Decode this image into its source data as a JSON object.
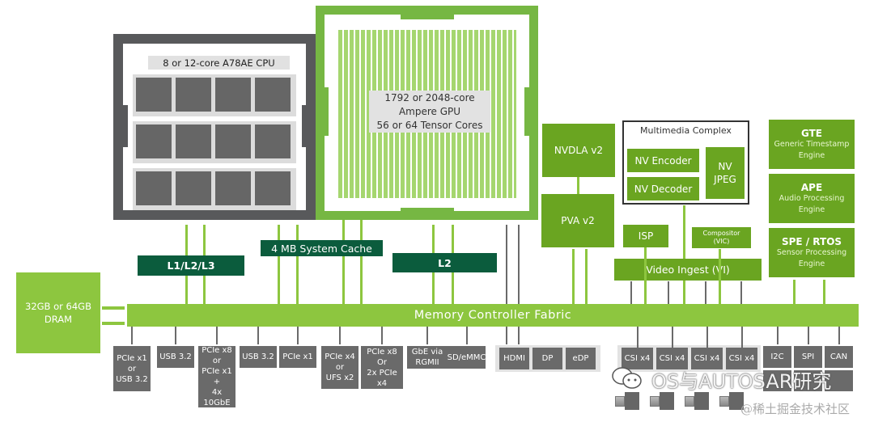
{
  "cpu": {
    "label": "8 or 12-core A78AE CPU",
    "core_rows": 3,
    "cores_per_row": 4
  },
  "gpu": {
    "label": "1792 or 2048-core\nAmpere GPU\n56 or 64 Tensor  Cores"
  },
  "caches": {
    "cpu": "L1/L2/L3",
    "system": "4 MB System Cache",
    "gpu": "L2"
  },
  "fabric": {
    "label": "Memory Controller Fabric"
  },
  "dram": {
    "label": "32GB or 64GB\nDRAM"
  },
  "accelerators": {
    "nvdla": "NVDLA v2",
    "pva": "PVA v2"
  },
  "multimedia": {
    "title": "Multimedia Complex",
    "encoder": "NV Encoder",
    "decoder": "NV Decoder",
    "jpeg": "NV\nJPEG"
  },
  "video": {
    "isp": "ISP",
    "compositor": "Compositor\n(VIC)",
    "vi": "Video Ingest (VI)"
  },
  "engines": [
    {
      "name": "GTE",
      "desc": "Generic Timestamp\nEngine"
    },
    {
      "name": "APE",
      "desc": "Audio Processing\nEngine"
    },
    {
      "name": "SPE / RTOS",
      "desc": "Sensor Processing\nEngine"
    }
  ],
  "io": [
    "PCIe x1\nor\nUSB 3.2",
    "USB 3.2",
    "PCIe x8\nor\nPCIe x1\n+\n4x 10GbE",
    "USB 3.2",
    "PCIe x1",
    "PCIe x4\nor\nUFS x2",
    "PCIe x8\nOr\n2x PCIe x4",
    "GbE via\nRGMII",
    "SD/eMMC"
  ],
  "display": [
    "HDMI",
    "DP",
    "eDP"
  ],
  "csi": [
    "CSI x4",
    "CSI x4",
    "CSI x4",
    "CSI x4"
  ],
  "low_speed": [
    "I2C",
    "SPI",
    "CAN"
  ],
  "watermark": {
    "main": "OS与AUTOSAR研究",
    "sub": "@稀土掘金技术社区"
  },
  "colors": {
    "green": "#8dc63f",
    "dark_green": "#6aa521",
    "cache_green": "#0b5c3d",
    "gray": "#6a6a6a",
    "cpu_gray": "#58595b",
    "gpu_green": "#76b743"
  }
}
